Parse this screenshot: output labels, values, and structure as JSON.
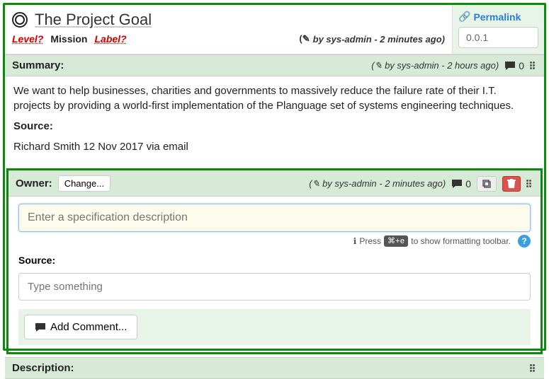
{
  "header": {
    "title": "The Project Goal",
    "level_label": "Level?",
    "mission_label": "Mission",
    "label_label": "Label?",
    "byline": "by sys-admin - 2 minutes ago)",
    "permalink_label": "Permalink",
    "version": "0.0.1"
  },
  "summary": {
    "title": "Summary:",
    "byline": "by sys-admin - 2 hours ago)",
    "comments": "0",
    "body": "We want to help businesses, charities and governments to massively reduce the failure rate of their I.T. projects by providing a world-first implementation of the Planguage set of systems engineering techniques.",
    "source_label": "Source:",
    "source_text": "Richard Smith 12 Nov 2017 via email"
  },
  "owner": {
    "title": "Owner:",
    "change_label": "Change...",
    "byline": "by sys-admin - 2 minutes ago)",
    "comments": "0",
    "spec_placeholder": "Enter a specification description",
    "hint_prefix": "Press",
    "hint_key": "⌘+e",
    "hint_suffix": "to show formatting toolbar.",
    "source_label": "Source:",
    "source_placeholder": "Type something",
    "add_comment_label": "Add Comment..."
  },
  "description": {
    "title": "Description:"
  }
}
